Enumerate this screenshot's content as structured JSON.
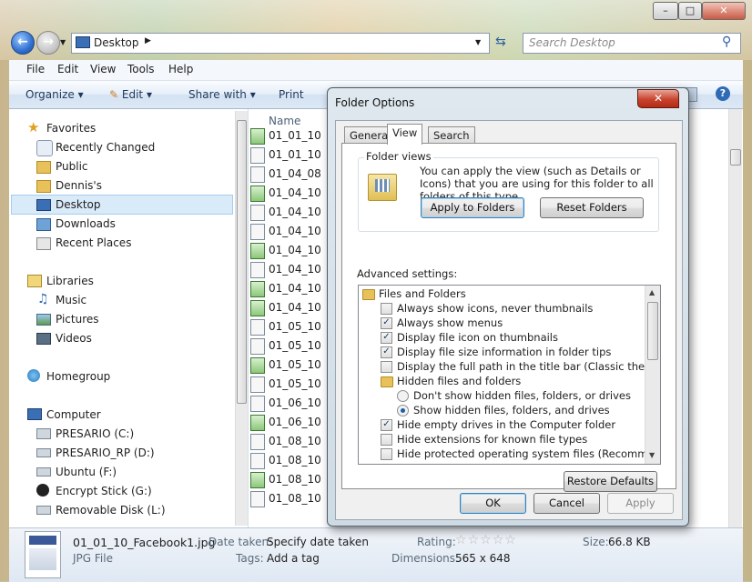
{
  "explorer": {
    "address": "Desktop",
    "search_placeholder": "Search Desktop",
    "menu": [
      "File",
      "Edit",
      "View",
      "Tools",
      "Help"
    ],
    "toolbar": {
      "organize": "Organize",
      "edit": "Edit",
      "share": "Share with",
      "print": "Print"
    },
    "nav": {
      "favorites": "Favorites",
      "fav_items": [
        "Recently Changed",
        "Public",
        "Dennis's",
        "Desktop",
        "Downloads",
        "Recent Places"
      ],
      "libraries": "Libraries",
      "lib_items": [
        "Music",
        "Pictures",
        "Videos"
      ],
      "homegroup": "Homegroup",
      "computer": "Computer",
      "comp_items": [
        "PRESARIO (C:)",
        "PRESARIO_RP (D:)",
        "Ubuntu (F:)",
        "Encrypt Stick (G:)",
        "Removable Disk (L:)"
      ]
    },
    "column_name": "Name",
    "files": [
      "01_01_10",
      "01_01_10",
      "01_04_08",
      "01_04_10",
      "01_04_10",
      "01_04_10",
      "01_04_10",
      "01_04_10",
      "01_04_10",
      "01_04_10",
      "01_05_10",
      "01_05_10",
      "01_05_10",
      "01_05_10",
      "01_06_10",
      "01_06_10",
      "01_08_10",
      "01_08_10",
      "01_08_10",
      "01_08_10"
    ],
    "details": {
      "filename": "01_01_10_Facebook1.jpg",
      "filetype": "JPG File",
      "date_label": "Date taken:",
      "date_value": "Specify date taken",
      "tags_label": "Tags:",
      "tags_value": "Add a tag",
      "rating_label": "Rating:",
      "dimensions_label": "Dimensions:",
      "dimensions_value": "565 x 648",
      "size_label": "Size:",
      "size_value": "66.8 KB"
    }
  },
  "dialog": {
    "title": "Folder Options",
    "tabs": [
      "General",
      "View",
      "Search"
    ],
    "folder_views_label": "Folder views",
    "folder_views_text": "You can apply the view (such as Details or Icons) that you are using for this folder to all folders of this type.",
    "apply_button": "Apply to Folders",
    "reset_button": "Reset Folders",
    "advanced_label": "Advanced settings:",
    "advanced_items": [
      {
        "kind": "folder",
        "label": "Files and Folders"
      },
      {
        "kind": "check",
        "checked": false,
        "label": "Always show icons, never thumbnails"
      },
      {
        "kind": "check",
        "checked": true,
        "label": "Always show menus"
      },
      {
        "kind": "check",
        "checked": true,
        "label": "Display file icon on thumbnails"
      },
      {
        "kind": "check",
        "checked": true,
        "label": "Display file size information in folder tips"
      },
      {
        "kind": "check",
        "checked": false,
        "label": "Display the full path in the title bar (Classic theme only)"
      },
      {
        "kind": "folder",
        "label": "Hidden files and folders"
      },
      {
        "kind": "radio",
        "checked": false,
        "label": "Don't show hidden files, folders, or drives"
      },
      {
        "kind": "radio",
        "checked": true,
        "label": "Show hidden files, folders, and drives"
      },
      {
        "kind": "check",
        "checked": true,
        "label": "Hide empty drives in the Computer folder"
      },
      {
        "kind": "check",
        "checked": false,
        "label": "Hide extensions for known file types"
      },
      {
        "kind": "check",
        "checked": false,
        "label": "Hide protected operating system files (Recommended)"
      }
    ],
    "restore_button": "Restore Defaults",
    "ok_button": "OK",
    "cancel_button": "Cancel",
    "apply_bottom_button": "Apply"
  }
}
